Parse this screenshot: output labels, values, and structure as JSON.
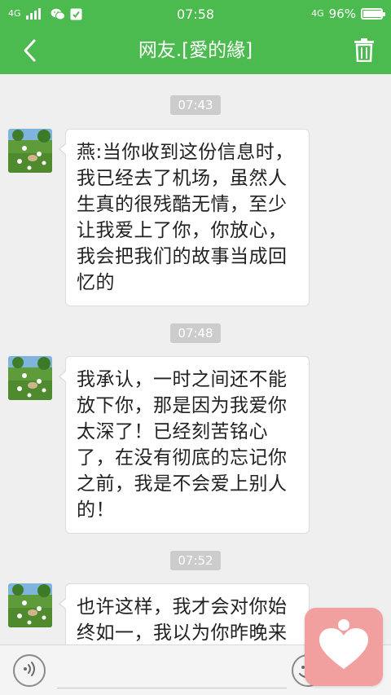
{
  "status_bar": {
    "network_left": "4G",
    "time": "07:58",
    "network_right": "4G",
    "battery_percent": "96%",
    "battery_level": 0.96
  },
  "header": {
    "title": "网友.[愛的緣]",
    "back_icon": "chevron-left-icon",
    "delete_icon": "trash-icon",
    "color": "#4cbb4f"
  },
  "messages": [
    {
      "timestamp": "07:43",
      "lines": [
        "燕:当你收到这份信息时，",
        "我已经去了机场，虽然人",
        "生真的很残酷无情，至少",
        "让我爱上了你，你放心，",
        "我会把我们的故事当成回",
        "忆的"
      ]
    },
    {
      "timestamp": "07:48",
      "lines": [
        "我承认，一时之间还不能",
        "放下你，那是因为我爱你",
        "太深了！已经刻苦铭心",
        "了，在没有彻底的忘记你",
        "之前，我是不会爱上别人",
        "的！"
      ]
    },
    {
      "timestamp": "07:52",
      "lines": [
        "也许这样，我才会对你始",
        "终如一，我以为你昨晚来"
      ]
    }
  ],
  "input_bar": {
    "voice_icon": "voice-icon",
    "emoji_icon": "emoji-icon",
    "message_value": ""
  },
  "floating_badge": {
    "icon": "heart-person-icon",
    "color": "#f29fa0"
  }
}
